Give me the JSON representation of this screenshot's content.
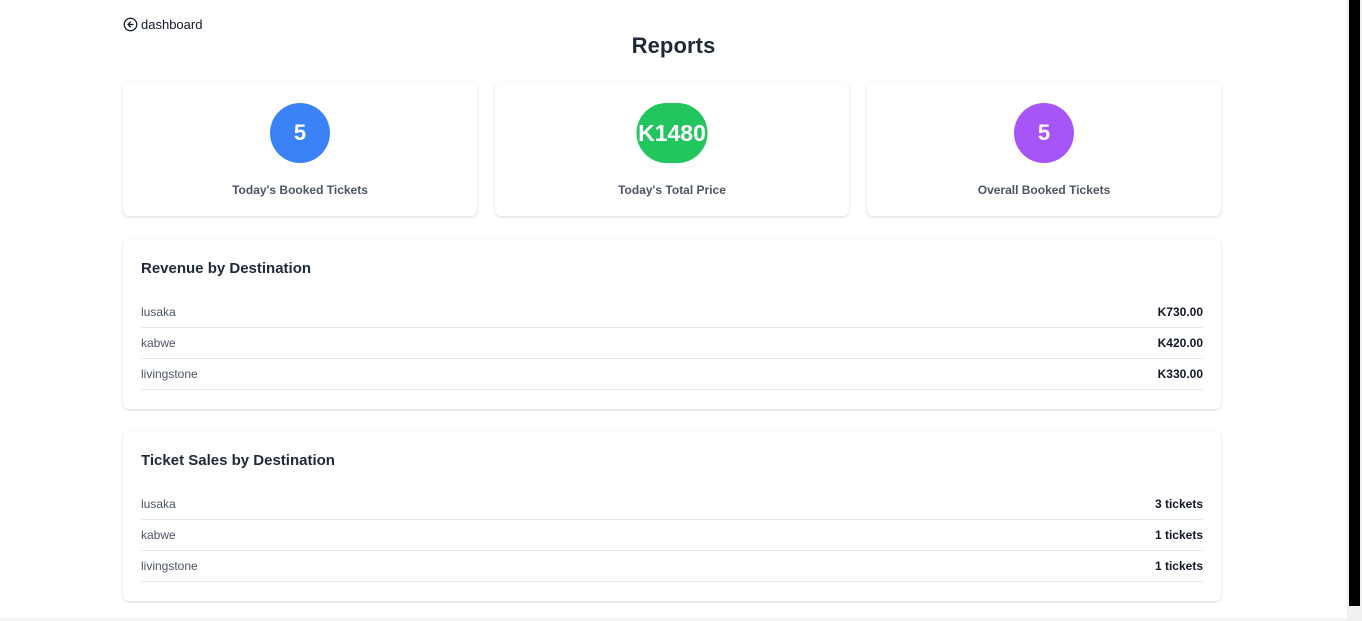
{
  "nav": {
    "back_label": "dashboard",
    "back_icon": "arrow-left-circle-icon"
  },
  "page": {
    "title": "Reports"
  },
  "stats": [
    {
      "value": "5",
      "label": "Today's Booked Tickets",
      "color": "#3b82f6"
    },
    {
      "value": "K1480",
      "label": "Today's Total Price",
      "color": "#22c55e"
    },
    {
      "value": "5",
      "label": "Overall Booked Tickets",
      "color": "#a855f7"
    }
  ],
  "revenue": {
    "title": "Revenue by Destination",
    "rows": [
      {
        "destination": "lusaka",
        "amount": "K730.00"
      },
      {
        "destination": "kabwe",
        "amount": "K420.00"
      },
      {
        "destination": "livingstone",
        "amount": "K330.00"
      }
    ]
  },
  "ticket_sales": {
    "title": "Ticket Sales by Destination",
    "rows": [
      {
        "destination": "lusaka",
        "count": "3 tickets"
      },
      {
        "destination": "kabwe",
        "count": "1 tickets"
      },
      {
        "destination": "livingstone",
        "count": "1 tickets"
      }
    ]
  }
}
